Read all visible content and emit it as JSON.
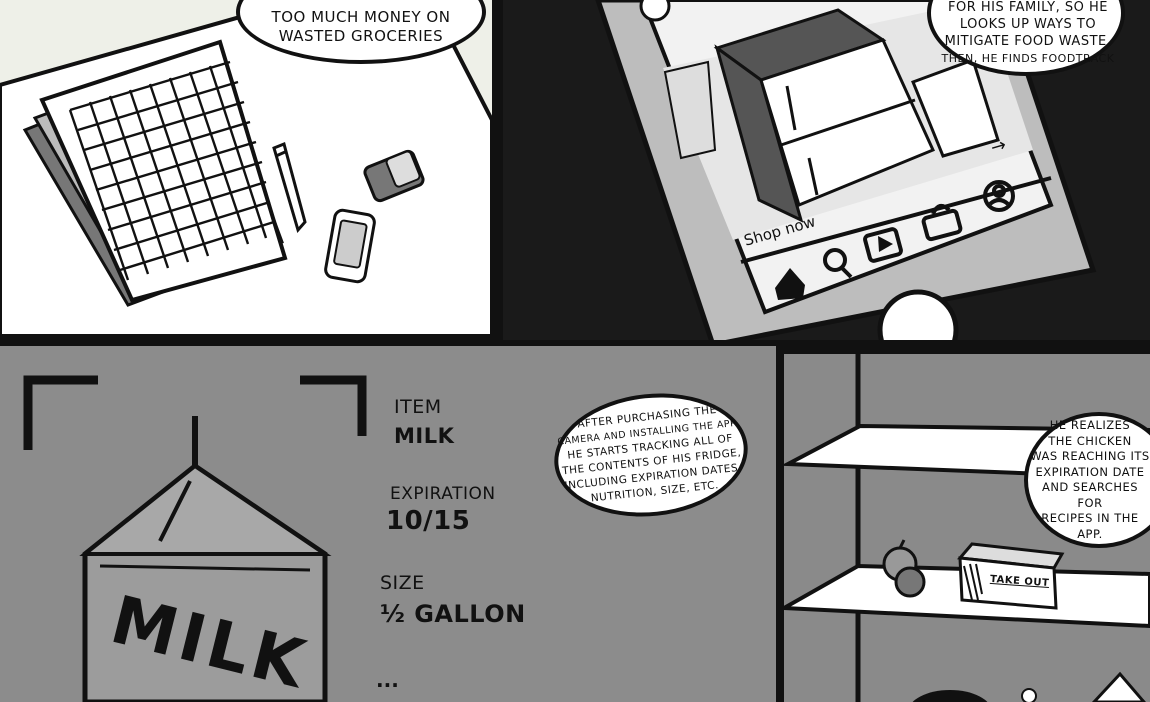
{
  "panels": {
    "desk": {
      "bubble_lines": [
        "Too much money on",
        "wasted groceries"
      ]
    },
    "phone": {
      "bubble_lines": [
        "for his family, so he",
        "looks up ways to",
        "mitigate food waste.",
        "Then, he finds Foodtrack"
      ],
      "banner_label": "Shop now",
      "arrow_glyph": "→",
      "nav_icons": [
        "home-icon",
        "search-icon",
        "play-icon",
        "bag-icon",
        "profile-icon"
      ]
    },
    "scan": {
      "item_label": "Item",
      "item_value": "Milk",
      "expiration_label": "Expiration",
      "expiration_value": "10/15",
      "size_label": "Size",
      "size_value": "½ Gallon",
      "more": "...",
      "carton_text": "MILK",
      "bubble_lines": [
        "After purchasing the",
        "camera and installing the app,",
        "he starts tracking all of",
        "the contents of his fridge,",
        "including expiration dates,",
        "nutrition, size, etc."
      ]
    },
    "fridge": {
      "box_label": "Take out",
      "bubble_lines": [
        "He realizes",
        "the chicken",
        "was reaching its",
        "expiration date",
        "and searches for",
        "recipes in the",
        "app."
      ]
    }
  },
  "colors": {
    "ink": "#111111",
    "paper": "#ffffff",
    "panel_light": "#eef0e8",
    "panel_grey": "#8c8c8c",
    "carton": "#9c9c9c"
  }
}
